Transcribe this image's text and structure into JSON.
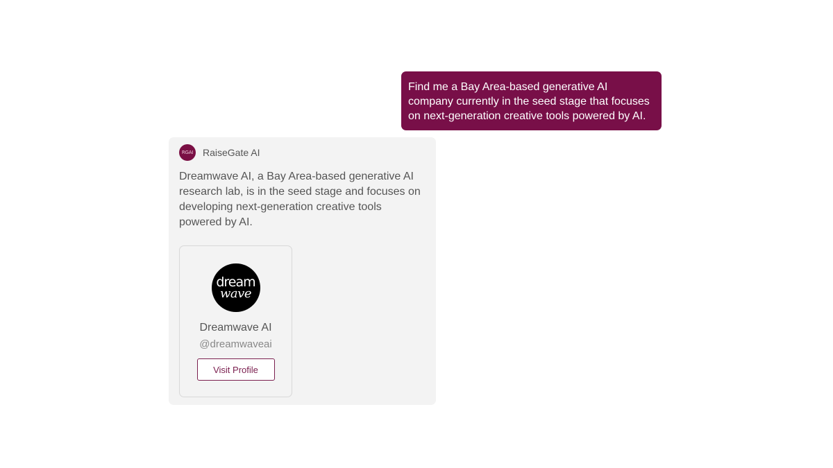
{
  "user_message": {
    "text": "Find me a Bay Area-based generative AI company currently in the seed stage that focuses on next-generation creative tools powered by AI."
  },
  "assistant": {
    "name": "RaiseGate AI",
    "avatar_text": "RGAI",
    "message": "Dreamwave AI, a Bay Area-based generative AI research lab, is in the seed stage and focuses on developing next-generation creative tools powered by AI.",
    "profile": {
      "logo_top": "dream",
      "logo_bottom": "wave",
      "name": "Dreamwave AI",
      "handle": "@dreamwaveai",
      "button_label": "Visit Profile"
    }
  },
  "colors": {
    "accent": "#780f48",
    "card_bg": "#f3f3f3",
    "text": "#555555"
  }
}
